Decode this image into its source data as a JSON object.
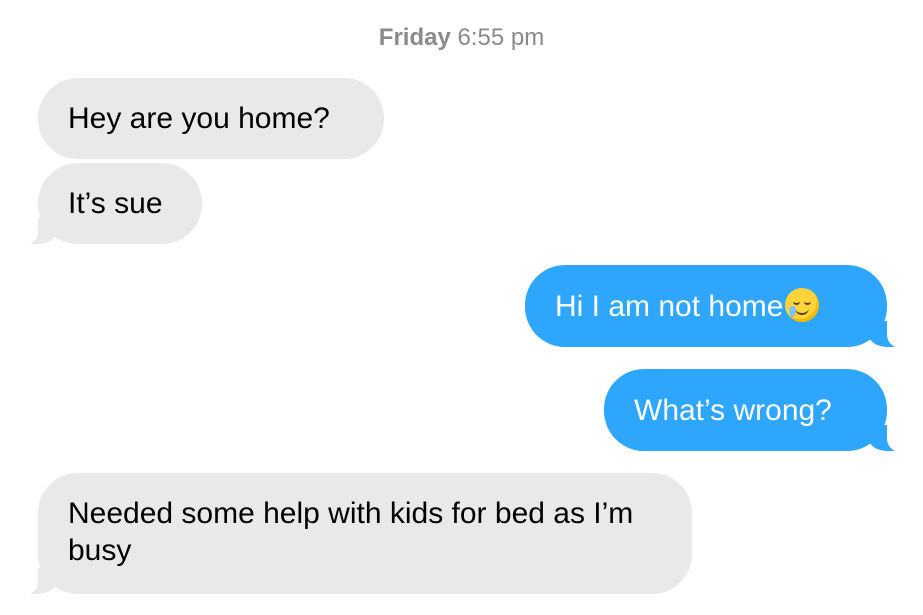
{
  "conversation": {
    "timestamp": {
      "day": "Friday",
      "time": "6:55 pm"
    },
    "messages": [
      {
        "direction": "incoming",
        "text": "Hey are you home?"
      },
      {
        "direction": "incoming",
        "text": "It’s sue"
      },
      {
        "direction": "outgoing",
        "text": "Hi I am not home",
        "emoji": "smiling-face-with-tear-icon"
      },
      {
        "direction": "outgoing",
        "text": "What’s wrong?"
      },
      {
        "direction": "incoming",
        "text": "Needed some help with kids for bed as I’m busy"
      }
    ]
  },
  "colors": {
    "incoming_bubble": "#e9e9eb",
    "outgoing_bubble": "#2ea6fb",
    "timestamp_text": "#8a8a8e"
  }
}
